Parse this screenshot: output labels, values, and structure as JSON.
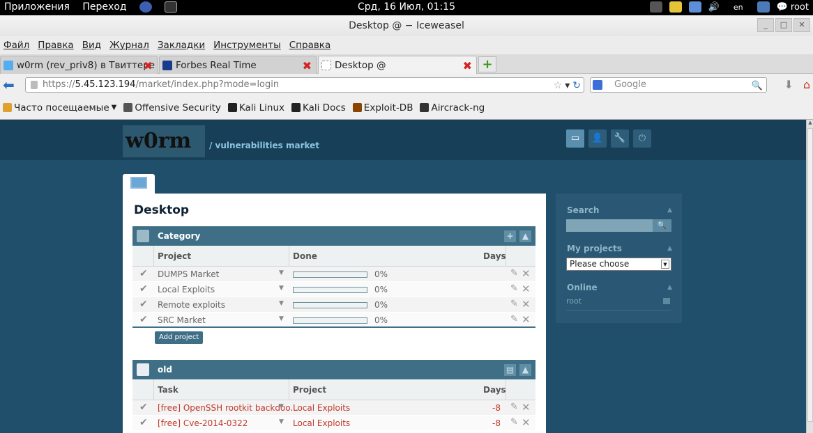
{
  "desktop": {
    "apps": "Приложения",
    "places": "Переход",
    "clock": "Срд, 16 Июл, 01:15",
    "lang": "en",
    "user": "root"
  },
  "window": {
    "title": "Desktop @ − Iceweasel"
  },
  "menu": [
    "Файл",
    "Правка",
    "Вид",
    "Журнал",
    "Закладки",
    "Инструменты",
    "Справка"
  ],
  "tabs": [
    {
      "label": "w0rm (rev_priv8) в Твиттере",
      "icon": "twitter-icon",
      "color": "#55acee"
    },
    {
      "label": "Forbes Real Time",
      "icon": "forbes-icon",
      "color": "#1a3a8c"
    },
    {
      "label": "Desktop @",
      "icon": "blank-page-icon",
      "color": "#ffffff"
    }
  ],
  "nav": {
    "url_prefix": "https://",
    "url_host": "5.45.123.194",
    "url_path": "/market/index.php?mode=login",
    "search_placeholder": "Google"
  },
  "bookmarks": [
    "Часто посещаемые",
    "Offensive Security",
    "Kali Linux",
    "Kali Docs",
    "Exploit-DB",
    "Aircrack-ng"
  ],
  "site": {
    "logo_text": "w0rm",
    "tagline": "/ vulnerabilities market",
    "page_title": "Desktop"
  },
  "category": {
    "title": "Category",
    "headers": {
      "project": "Project",
      "done": "Done",
      "days": "Days"
    },
    "rows": [
      {
        "name": "DUMPS Market",
        "pct": "0%",
        "progress": 0
      },
      {
        "name": "Local Exploits",
        "pct": "0%",
        "progress": 0
      },
      {
        "name": "Remote exploits",
        "pct": "0%",
        "progress": 0
      },
      {
        "name": "SRC Market",
        "pct": "0%",
        "progress": 0
      }
    ],
    "add_label": "Add project"
  },
  "old": {
    "title": "old",
    "headers": {
      "task": "Task",
      "project": "Project",
      "days": "Days"
    },
    "rows": [
      {
        "task": "[free] OpenSSH rootkit backdoo...",
        "project": "Local Exploits",
        "days": "-8"
      },
      {
        "task": "[free] Cve-2014-0322",
        "project": "Local Exploits",
        "days": "-8"
      }
    ]
  },
  "sidebar": {
    "search_title": "Search",
    "projects_title": "My projects",
    "projects_value": "Please choose",
    "online_title": "Online",
    "online_user": "root"
  },
  "colors": {
    "page_bg": "#1f4f6b",
    "header_bg": "#173f58",
    "panel_head": "#3e6f86",
    "sidebar_bg": "#2a5874",
    "accent_red": "#c0392b"
  }
}
